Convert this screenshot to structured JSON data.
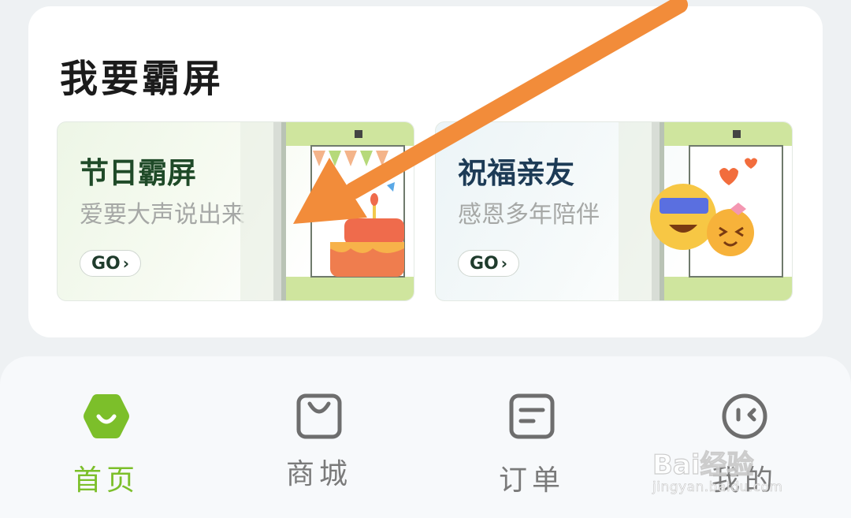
{
  "section": {
    "title": "我要霸屏"
  },
  "cards": [
    {
      "title": "节日霸屏",
      "subtitle": "爱要大声说出来",
      "cta": "GO"
    },
    {
      "title": "祝福亲友",
      "subtitle": "感恩多年陪伴",
      "cta": "GO"
    }
  ],
  "tabbar": {
    "items": [
      {
        "label": "首页",
        "icon": "home-icon",
        "active": true
      },
      {
        "label": "商城",
        "icon": "shopping-bag-icon",
        "active": false
      },
      {
        "label": "订单",
        "icon": "order-icon",
        "active": false
      },
      {
        "label": "我的",
        "icon": "profile-icon",
        "active": false
      }
    ]
  },
  "watermark": {
    "brand": "Bai经验",
    "url": "jingyan.baidu.com"
  },
  "colors": {
    "accent_green": "#7cbf2a",
    "annotation_arrow": "#f28c3a",
    "inactive_tab": "#7a7a7a"
  }
}
